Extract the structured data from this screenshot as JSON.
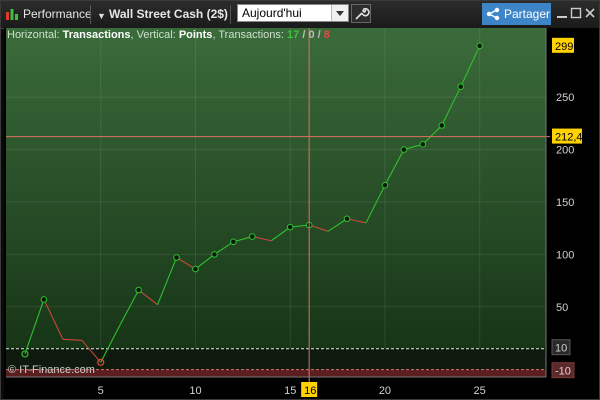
{
  "toolbar": {
    "view_label": "Performance",
    "instrument_label": "Wall Street Cash (2$)",
    "period_value": "Aujourd'hui",
    "share_label": "Partager",
    "icons": [
      "performance-icon",
      "dropdown-arrow-icon",
      "wrench-icon",
      "share-icon",
      "minimize-icon",
      "maximize-icon",
      "close-icon"
    ]
  },
  "info": {
    "horizontal_prefix": "Horizontal:",
    "horizontal_value": "Transactions",
    "vertical_prefix": ", Vertical:",
    "vertical_value": "Points",
    "transactions_prefix": ", Transactions:",
    "wins": "17",
    "slash1": " / ",
    "neutral": "0",
    "slash2": " / ",
    "losses": "8"
  },
  "copyright": "© IT-Finance.com",
  "chart_data": {
    "type": "line",
    "xlabel": "",
    "ylabel": "",
    "x": [
      1,
      2,
      3,
      4,
      5,
      6,
      7,
      8,
      9,
      10,
      11,
      12,
      13,
      14,
      15,
      16,
      17,
      18,
      19,
      20,
      21,
      22,
      23,
      24,
      25
    ],
    "values": [
      5,
      57,
      19,
      18,
      -3,
      32,
      66,
      52,
      97,
      86,
      100,
      112,
      117,
      113,
      126,
      128,
      122,
      134,
      130,
      166,
      200,
      205,
      223,
      260,
      299
    ],
    "markers": [
      {
        "x": 1,
        "style": "hollow"
      },
      {
        "x": 2,
        "style": "filled"
      },
      {
        "x": 5,
        "style": "hollow-red"
      },
      {
        "x": 7,
        "style": "filled"
      },
      {
        "x": 9,
        "style": "filled"
      },
      {
        "x": 10,
        "style": "filled"
      },
      {
        "x": 11,
        "style": "filled"
      },
      {
        "x": 12,
        "style": "filled"
      },
      {
        "x": 13,
        "style": "filled"
      },
      {
        "x": 15,
        "style": "filled"
      },
      {
        "x": 16,
        "style": "filled"
      },
      {
        "x": 18,
        "style": "filled"
      },
      {
        "x": 20,
        "style": "filled"
      },
      {
        "x": 21,
        "style": "filled"
      },
      {
        "x": 22,
        "style": "filled"
      },
      {
        "x": 23,
        "style": "filled"
      },
      {
        "x": 24,
        "style": "filled"
      },
      {
        "x": 25,
        "style": "filled"
      }
    ],
    "xlim": [
      0,
      28.5
    ],
    "ylim": [
      -17,
      316
    ],
    "x_ticks": [
      5,
      10,
      15,
      20,
      25
    ],
    "y_ticks": [
      50,
      100,
      150,
      200,
      250
    ],
    "upper_threshold": 10,
    "lower_threshold": -10,
    "upper_threshold_label": "10",
    "lower_threshold_label": "-10",
    "last_value": 299,
    "last_value_label": "299",
    "crosshair": {
      "x": 16,
      "y": 212.4,
      "x_label": "16",
      "y_label": "212,4"
    },
    "colors": {
      "up_segment": "#2fc02f",
      "down_segment": "#c8483a",
      "crosshair": "#e07060",
      "label_bg": "#ffd200",
      "bg_top": "#3b6b3b",
      "bg_bottom": "#173517",
      "threshold_zone": "#0f1a0f",
      "loss_zone": "#5a1e1e"
    }
  }
}
